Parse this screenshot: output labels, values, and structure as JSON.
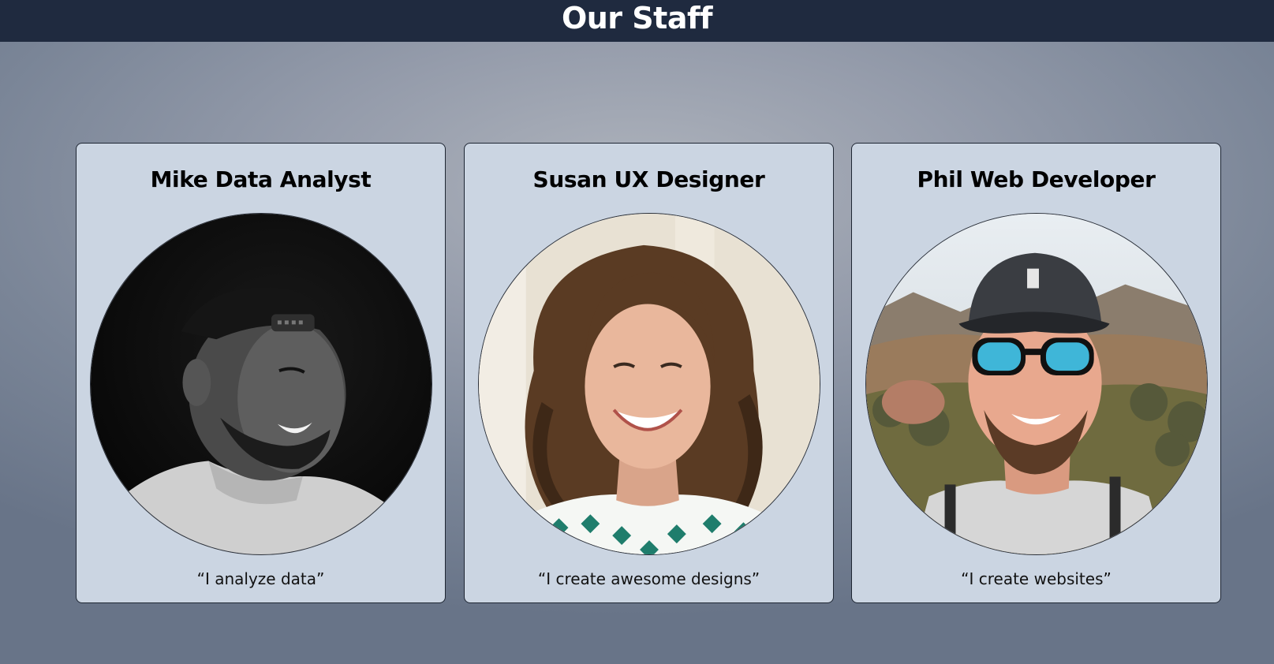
{
  "page": {
    "title": "Our Staff",
    "header_bg": "#1f2a3f",
    "card_bg": "#cbd5e2"
  },
  "staff": [
    {
      "name": "Mike Data Analyst",
      "quote": "“I analyze data”",
      "photo": "man-backwards-cap-bw-photo"
    },
    {
      "name": "Susan UX Designer",
      "quote": "“I create awesome designs”",
      "photo": "smiling-woman-curly-hair-photo"
    },
    {
      "name": "Phil Web Developer",
      "quote": "“I create websites”",
      "photo": "man-cap-sunglasses-mountains-photo"
    }
  ]
}
